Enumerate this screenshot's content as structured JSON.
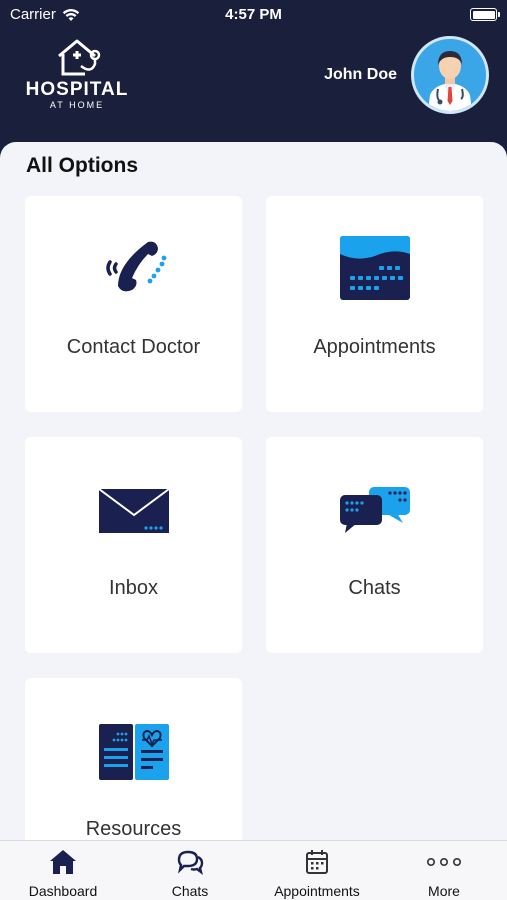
{
  "status_bar": {
    "carrier": "Carrier",
    "time": "4:57 PM"
  },
  "header": {
    "logo_title": "HOSPITAL",
    "logo_subtitle": "AT HOME",
    "user_name": "John Doe"
  },
  "colors": {
    "navy": "#1a1f3c",
    "accent": "#1aa3ec",
    "icon_dark": "#1a2150"
  },
  "main": {
    "title": "All Options",
    "options": [
      {
        "label": "Contact Doctor",
        "icon": "phone-icon"
      },
      {
        "label": "Appointments",
        "icon": "calendar-icon"
      },
      {
        "label": "Inbox",
        "icon": "envelope-icon"
      },
      {
        "label": "Chats",
        "icon": "chat-bubbles-icon"
      },
      {
        "label": "Resources",
        "icon": "resources-icon"
      }
    ]
  },
  "tabbar": {
    "tabs": [
      {
        "label": "Dashboard",
        "icon": "home-icon",
        "active": true
      },
      {
        "label": "Chats",
        "icon": "chat-icon"
      },
      {
        "label": "Appointments",
        "icon": "calendar-icon"
      },
      {
        "label": "More",
        "icon": "more-icon"
      }
    ]
  }
}
